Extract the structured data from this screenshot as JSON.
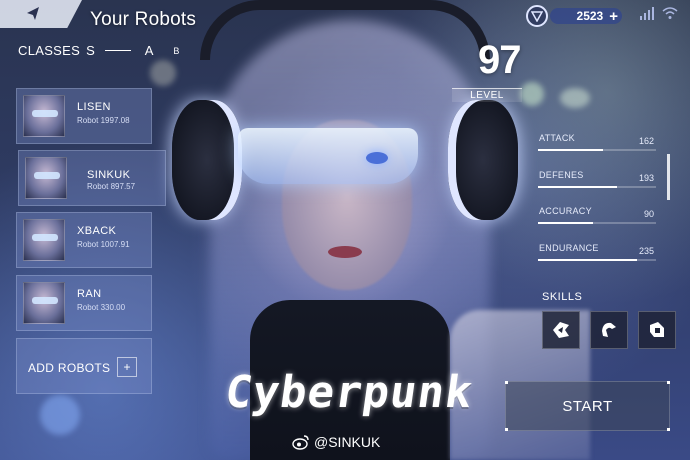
{
  "header": {
    "title": "Your Robots",
    "back_icon": "back-arrow-icon",
    "currency_icon": "shield-coin-icon",
    "currency_amount": "2523",
    "add_currency_icon": "plus-icon",
    "signal_icon": "signal-icon",
    "wifi_icon": "wifi-icon"
  },
  "classes": {
    "label": "CLASSES",
    "tabs": [
      "S",
      "A",
      "B"
    ],
    "selected": "S"
  },
  "robots": [
    {
      "name": "LISEN",
      "type": "Robot",
      "value": "1997.08",
      "selected": false
    },
    {
      "name": "SINKUK",
      "type": "Robot",
      "value": "897.57",
      "selected": true
    },
    {
      "name": "XBACK",
      "type": "Robot",
      "value": "1007.91",
      "selected": false
    },
    {
      "name": "RAN",
      "type": "Robot",
      "value": "330.00",
      "selected": false
    }
  ],
  "add_robots": {
    "label": "ADD ROBOTS",
    "plus": "+"
  },
  "level": {
    "value": "97",
    "label": "LEVEL"
  },
  "stats": [
    {
      "name": "ATTACK",
      "value": 162,
      "fill": 0.55
    },
    {
      "name": "DEFENES",
      "value": 193,
      "fill": 0.67
    },
    {
      "name": "ACCURACY",
      "value": 90,
      "fill": 0.47
    },
    {
      "name": "ENDURANCE",
      "value": 235,
      "fill": 0.84
    }
  ],
  "skills": {
    "label": "SKILLS",
    "icons": [
      "skill-strike-icon",
      "skill-spin-icon",
      "skill-block-icon"
    ]
  },
  "logo_text": "Cyberpunk",
  "credit": "@SINKUK",
  "start_label": "START",
  "colors": {
    "panel": "#7c8cc8",
    "accent": "#ffffff",
    "coin_bar": "#32468c"
  }
}
